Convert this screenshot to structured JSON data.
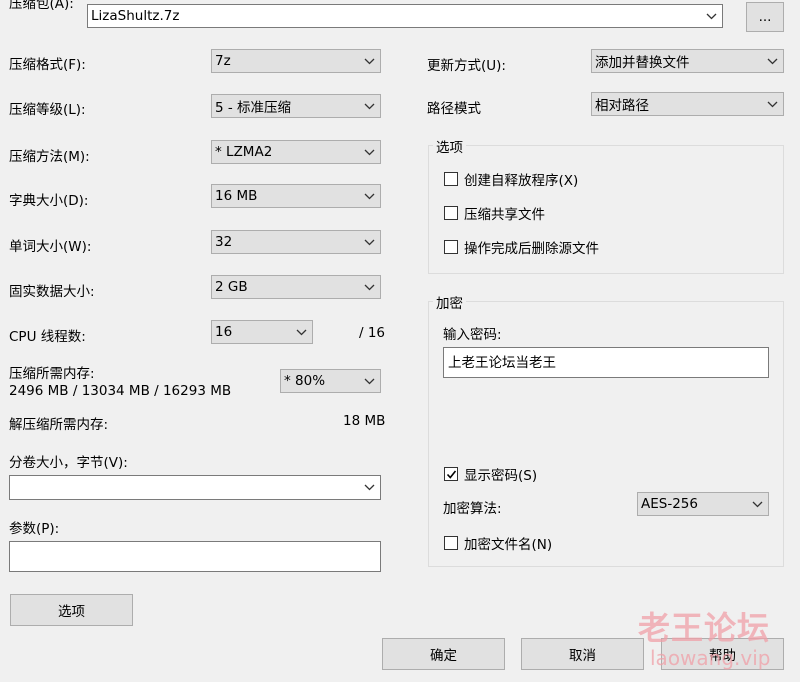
{
  "archive": {
    "label": "压缩包(A):",
    "value": "LizaShultz.7z",
    "browse_label": "..."
  },
  "left": {
    "format": {
      "label": "压缩格式(F):",
      "value": "7z"
    },
    "level": {
      "label": "压缩等级(L):",
      "value": "5 - 标准压缩"
    },
    "method": {
      "label": "压缩方法(M):",
      "value": "*  LZMA2"
    },
    "dict": {
      "label": "字典大小(D):",
      "value": "16 MB"
    },
    "word": {
      "label": "单词大小(W):",
      "value": "32"
    },
    "solid": {
      "label": "固实数据大小:",
      "value": "2 GB"
    },
    "threads": {
      "label": "CPU 线程数:",
      "value": "16",
      "total": "/ 16"
    },
    "mem_comp": {
      "label": "压缩所需内存:",
      "detail": "2496 MB / 13034 MB / 16293 MB",
      "value": "* 80%"
    },
    "mem_decomp": {
      "label": "解压缩所需内存:",
      "value": "18 MB"
    },
    "split": {
      "label": "分卷大小，字节(V):",
      "value": ""
    },
    "params": {
      "label": "参数(P):",
      "value": ""
    },
    "options_button": "选项"
  },
  "right": {
    "update": {
      "label": "更新方式(U):",
      "value": "添加并替换文件"
    },
    "pathmode": {
      "label": "路径模式",
      "value": "相对路径"
    },
    "options_group": {
      "title": "选项",
      "sfx": "创建自释放程序(X)",
      "shared": "压缩共享文件",
      "delete": "操作完成后删除源文件"
    },
    "encryption": {
      "title": "加密",
      "password_label": "输入密码:",
      "password_value": "上老王论坛当老王",
      "show_password": "显示密码(S)",
      "method_label": "加密算法:",
      "method_value": "AES-256",
      "encrypt_names": "加密文件名(N)"
    }
  },
  "footer": {
    "ok": "确定",
    "cancel": "取消",
    "help": "帮助"
  },
  "watermark": {
    "line1": "老王论坛",
    "line2": "laowang.vip"
  },
  "colors": {
    "window_bg": "#f0f0f0",
    "button_bg": "#e1e1e1",
    "watermark": "#f0a0a8"
  }
}
